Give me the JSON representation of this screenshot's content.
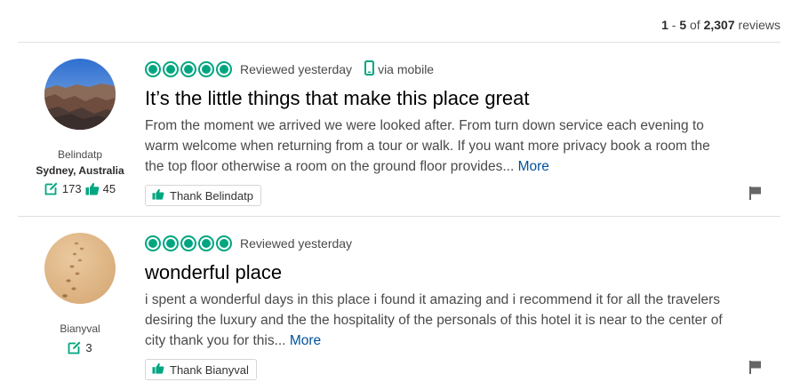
{
  "pagination": {
    "range_start": "1",
    "sep": " - ",
    "range_end": "5",
    "of": " of ",
    "total": "2,307",
    "suffix": " reviews"
  },
  "reviews": [
    {
      "username": "Belindatp",
      "location": "Sydney, Australia",
      "contributions": "173",
      "helpful_votes": "45",
      "rating": 5,
      "date": "Reviewed yesterday",
      "via": "via mobile",
      "title": "It’s the little things that make this place great",
      "body": "From the moment we arrived we were looked after. From turn down service each evening to warm welcome when returning from a tour or walk. If you want more privacy book a room the the top floor otherwise a room on the ground floor provides...",
      "more": "More",
      "thank": "Thank Belindatp"
    },
    {
      "username": "Bianyval",
      "contributions": "3",
      "rating": 5,
      "date": "Reviewed yesterday",
      "title": "wonderful place",
      "body": "i spent a wonderful days in this place i found it amazing and i recommend it for all the travelers desiring the luxury and the the hospitality of the personals of this hotel it is near to the center of city thank you for this...",
      "more": "More",
      "thank": "Thank Bianyval"
    }
  ],
  "colors": {
    "rating_green": "#00a680",
    "link_blue": "#00529b"
  },
  "icons": {
    "review_count": "pencil-square-icon",
    "helpful": "thumbs-up-icon",
    "mobile": "phone-icon",
    "thank": "thumbs-up-icon",
    "report": "flag-icon"
  }
}
